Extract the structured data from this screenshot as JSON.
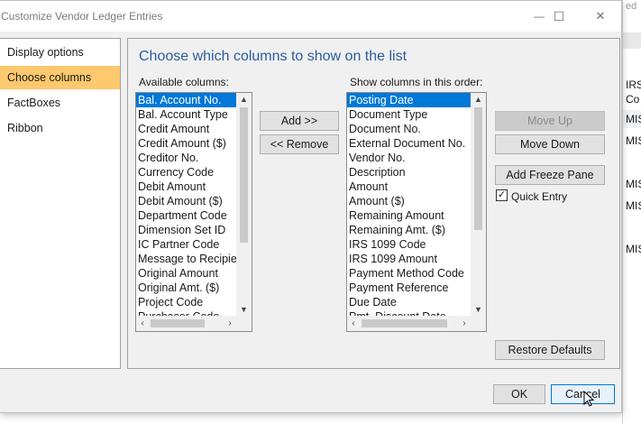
{
  "window": {
    "title": "Customize Vendor Ledger Entries",
    "minimize_glyph": "—",
    "maximize_glyph": "☐",
    "close_glyph": "✕"
  },
  "nav": {
    "items": [
      {
        "label": "Display options"
      },
      {
        "label": "Choose columns"
      },
      {
        "label": "FactBoxes"
      },
      {
        "label": "Ribbon"
      }
    ],
    "active_index": 1
  },
  "main": {
    "heading": "Choose which columns to show on the list",
    "available_label": "Available columns:",
    "show_label": "Show columns in this order:",
    "available_columns": [
      "Bal. Account No.",
      "Bal. Account Type",
      "Credit Amount",
      "Credit Amount ($)",
      "Creditor No.",
      "Currency Code",
      "Debit Amount",
      "Debit Amount ($)",
      "Department Code",
      "Dimension Set ID",
      "IC Partner Code",
      "Message to Recipient",
      "Original Amount",
      "Original Amt. ($)",
      "Project Code",
      "Purchaser Code"
    ],
    "show_columns": [
      "Posting Date",
      "Document Type",
      "Document No.",
      "External Document No.",
      "Vendor No.",
      "Description",
      "Amount",
      "Amount ($)",
      "Remaining Amount",
      "Remaining Amt. ($)",
      "IRS 1099 Code",
      "IRS 1099 Amount",
      "Payment Method Code",
      "Payment Reference",
      "Due Date",
      "Pmt. Discount Date"
    ],
    "buttons": {
      "add": "Add >>",
      "remove": "<< Remove",
      "move_up": "Move Up",
      "move_down": "Move Down",
      "add_freeze_pane": "Add Freeze Pane",
      "restore_defaults": "Restore Defaults"
    },
    "quick_entry_label": "Quick Entry",
    "quick_entry_checked": true
  },
  "footer": {
    "ok": "OK",
    "cancel": "Cancel"
  },
  "background_app": {
    "top_text": "ed",
    "rows": [
      "IRS",
      "Co",
      "MIS",
      "MIS",
      "MIS",
      "MIS",
      "MIS"
    ]
  }
}
